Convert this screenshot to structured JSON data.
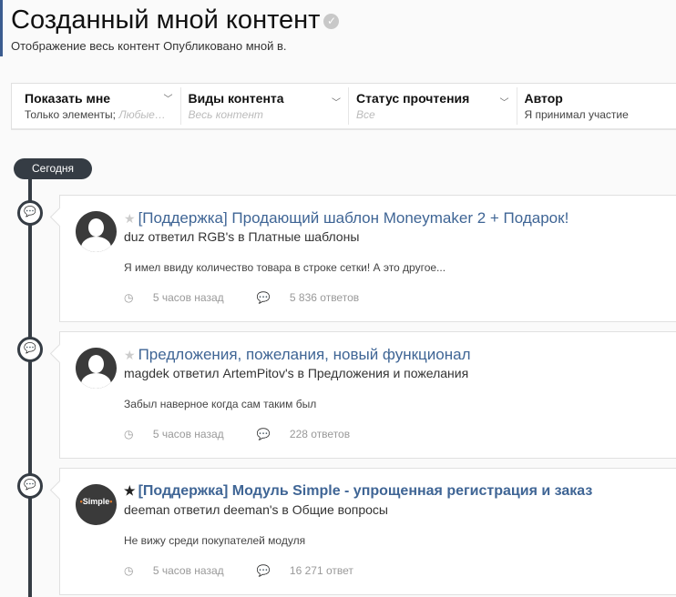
{
  "header": {
    "title": "Созданный мной контент",
    "subtitle": "Отображение весь контент Опубликовано мной в."
  },
  "filters": [
    {
      "label": "Показать мне",
      "value": "Только элементы;",
      "value_muted": "Любые…"
    },
    {
      "label": "Виды контента",
      "value": "",
      "value_muted": "Весь контент"
    },
    {
      "label": "Статус прочтения",
      "value": "",
      "value_muted": "Все"
    },
    {
      "label": "Автор",
      "value": "Я принимал участие",
      "value_muted": ""
    }
  ],
  "timeline": {
    "label": "Сегодня"
  },
  "items": [
    {
      "title": "[Поддержка] Продающий шаблон Moneymaker 2 + Подарок!",
      "meta": "duz ответил RGB's в Платные шаблоны",
      "snippet": "Я имел ввиду количество товара в строке сетки! А это другое...",
      "time": "5 часов назад",
      "replies": "5 836 ответов"
    },
    {
      "title": "Предложения, пожелания, новый функционал",
      "meta": "magdek ответил ArtemPitov's в Предложения и пожелания",
      "snippet": "Забыл наверное когда сам таким был",
      "time": "5 часов назад",
      "replies": "228 ответов"
    },
    {
      "title": "[Поддержка] Модуль Simple - упрощенная регистрация и заказ",
      "meta": "deeman ответил deeman's в Общие вопросы",
      "snippet": "Не вижу среди покупателей модуля",
      "time": "5 часов назад",
      "replies": "16 271 ответ",
      "avatar_logo": "Simple"
    }
  ]
}
